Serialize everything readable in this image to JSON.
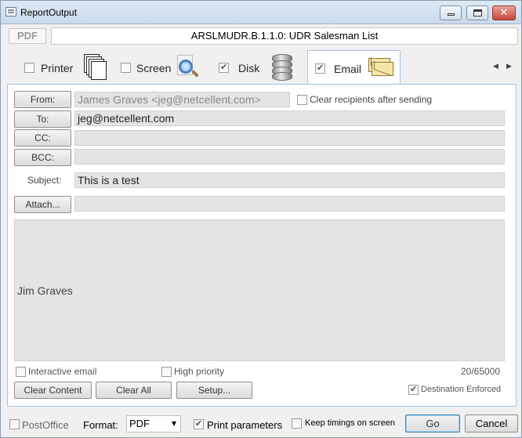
{
  "window": {
    "title": "ReportOutput",
    "close_glyph": "✕"
  },
  "header": {
    "format_badge": "PDF",
    "report_title": "ARSLMUDR.B.1.1.0: UDR Salesman List"
  },
  "tabs": [
    {
      "label": "Printer",
      "checked": false,
      "icon": "printer-icon"
    },
    {
      "label": "Screen",
      "checked": false,
      "icon": "magnifier-icon"
    },
    {
      "label": "Disk",
      "checked": true,
      "icon": "disk-icon"
    },
    {
      "label": "Email",
      "checked": true,
      "icon": "envelope-icon",
      "active": true
    }
  ],
  "tab_scroll": {
    "left": "◀",
    "right": "▶"
  },
  "email": {
    "from_button": "From:",
    "from_value": "James Graves <jeg@netcellent.com>",
    "clear_recipients_label": "Clear recipients after sending",
    "to_button": "To:",
    "to_value": "jeg@netcellent.com",
    "cc_button": "CC:",
    "cc_value": "",
    "bcc_button": "BCC:",
    "bcc_value": "",
    "subject_label": "Subject:",
    "subject_value": "This is a test",
    "attach_button": "Attach...",
    "attach_value": "",
    "body": "Jim Graves",
    "interactive_email_label": "Interactive email",
    "high_priority_label": "High priority",
    "char_count": "20/65000",
    "clear_content_button": "Clear Content",
    "clear_all_button": "Clear All",
    "setup_button": "Setup...",
    "destination_enforced_label": "Destination Enforced"
  },
  "footer": {
    "postoffice_label": "PostOffice",
    "format_label": "Format:",
    "format_value": "PDF",
    "print_parameters_label": "Print parameters",
    "keep_timings_label": "Keep timings on screen",
    "go_button": "Go",
    "cancel_button": "Cancel"
  }
}
